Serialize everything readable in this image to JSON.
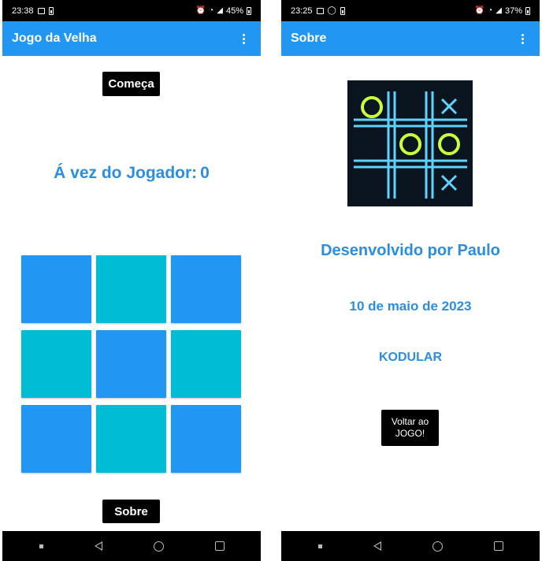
{
  "left_screen": {
    "status": {
      "time": "23:38",
      "battery": "45%"
    },
    "appbar": {
      "title": "Jogo da Velha",
      "menu_icon": "more-vert-icon"
    },
    "start_button": "Começa",
    "turn_label": "Á vez do Jogador:",
    "turn_value": "0",
    "board": {
      "cells": [
        "blue",
        "cyan",
        "blue",
        "cyan",
        "blue",
        "cyan",
        "blue",
        "cyan",
        "blue"
      ]
    },
    "about_button": "Sobre"
  },
  "right_screen": {
    "status": {
      "time": "23:25",
      "battery": "37%"
    },
    "appbar": {
      "title": "Sobre",
      "menu_icon": "more-vert-icon"
    },
    "developer": "Desenvolvido por Paulo",
    "date": "10 de maio de 2023",
    "platform": "KODULAR",
    "back_button": "Voltar ao JOGO!"
  },
  "colors": {
    "appbar": "#2196f3",
    "text_blue": "#2b8ee3",
    "cell_blue": "#2196f3",
    "cell_cyan": "#00bcd4",
    "logo_grid": "#5fd3ff",
    "logo_o": "#c9ff3b"
  }
}
